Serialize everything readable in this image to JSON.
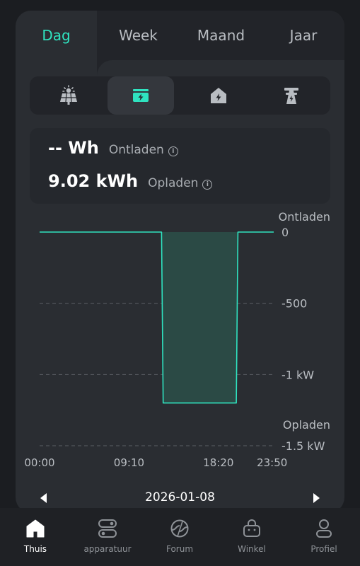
{
  "tabs": [
    {
      "label": "Dag",
      "active": true
    },
    {
      "label": "Week",
      "active": false
    },
    {
      "label": "Maand",
      "active": false
    },
    {
      "label": "Jaar",
      "active": false
    }
  ],
  "categories": [
    {
      "icon": "solar-panel-icon",
      "active": false
    },
    {
      "icon": "battery-charge-icon",
      "active": true
    },
    {
      "icon": "home-icon",
      "active": false
    },
    {
      "icon": "power-grid-icon",
      "active": false
    }
  ],
  "summary": {
    "discharge_value": "-- Wh",
    "discharge_label": "Ontladen",
    "charge_value": "9.02 kWh",
    "charge_label": "Opladen"
  },
  "chart_data": {
    "type": "area",
    "top_label": "Ontladen",
    "bottom_label": "Opladen",
    "y_ticks": [
      {
        "value": 0,
        "label": "0"
      },
      {
        "value": -500,
        "label": "-500"
      },
      {
        "value": -1000,
        "label": "-1 kW"
      },
      {
        "value": -1500,
        "label": "-1.5 kW"
      }
    ],
    "ylim": [
      -1500,
      0
    ],
    "x_ticks": [
      {
        "minutes": 0,
        "label": "00:00"
      },
      {
        "minutes": 550,
        "label": "09:10"
      },
      {
        "minutes": 1100,
        "label": "18:20"
      },
      {
        "minutes": 1430,
        "label": "23:50"
      }
    ],
    "xlim_minutes": [
      0,
      1440
    ],
    "series": [
      {
        "minutes": [
          0,
          750,
          760,
          1210,
          1220,
          1440
        ],
        "values": [
          0,
          0,
          -1200,
          -1200,
          0,
          0
        ]
      }
    ],
    "line_color": "#2fe3c0",
    "fill_color": "#2b4a45"
  },
  "date": {
    "value": "2026-01-08"
  },
  "nav": [
    {
      "label": "Thuis",
      "icon": "home-icon",
      "active": true
    },
    {
      "label": "apparatuur",
      "icon": "devices-icon",
      "active": false
    },
    {
      "label": "Forum",
      "icon": "forum-icon",
      "active": false
    },
    {
      "label": "Winkel",
      "icon": "shop-icon",
      "active": false
    },
    {
      "label": "Profiel",
      "icon": "profile-icon",
      "active": false
    }
  ],
  "colors": {
    "accent": "#2fe3c0",
    "card": "#2a2d32",
    "background": "#1b1d21"
  }
}
